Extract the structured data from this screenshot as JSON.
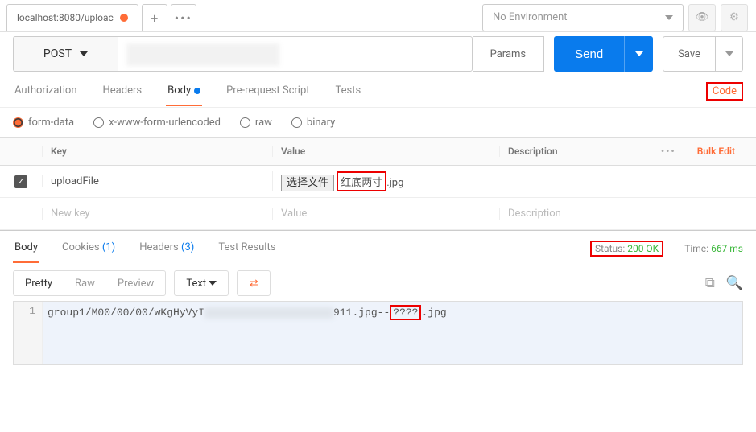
{
  "tabs": {
    "active_label": "localhost:8080/uploac"
  },
  "env": {
    "selected": "No Environment"
  },
  "request": {
    "method": "POST",
    "params_btn": "Params",
    "send_btn": "Send",
    "save_btn": "Save"
  },
  "req_tabs": {
    "authorization": "Authorization",
    "headers": "Headers",
    "body": "Body",
    "prerequest": "Pre-request Script",
    "tests": "Tests",
    "code": "Code"
  },
  "body_types": {
    "form_data": "form-data",
    "urlencoded": "x-www-form-urlencoded",
    "raw": "raw",
    "binary": "binary"
  },
  "kv": {
    "key_header": "Key",
    "value_header": "Value",
    "desc_header": "Description",
    "bulk_edit": "Bulk Edit",
    "row1_key": "uploadFile",
    "row1_file_button": "选择文件",
    "row1_file_name_boxed": "红底两寸",
    "row1_file_ext": ".jpg",
    "placeholder_key": "New key",
    "placeholder_value": "Value",
    "placeholder_desc": "Description"
  },
  "response": {
    "body_tab": "Body",
    "cookies_tab": "Cookies",
    "cookies_count": "(1)",
    "headers_tab": "Headers",
    "headers_count": "(3)",
    "tests_tab": "Test Results",
    "status_label": "Status:",
    "status_value": "200 OK",
    "time_label": "Time:",
    "time_value": "667 ms"
  },
  "resp_toolbar": {
    "pretty": "Pretty",
    "raw": "Raw",
    "preview": "Preview",
    "format": "Text"
  },
  "resp_body": {
    "line_no": "1",
    "prefix": "group1/M00/00/00/wKgHyVyI",
    "middle": "911.jpg--",
    "boxed": "????",
    "suffix": ".jpg"
  }
}
